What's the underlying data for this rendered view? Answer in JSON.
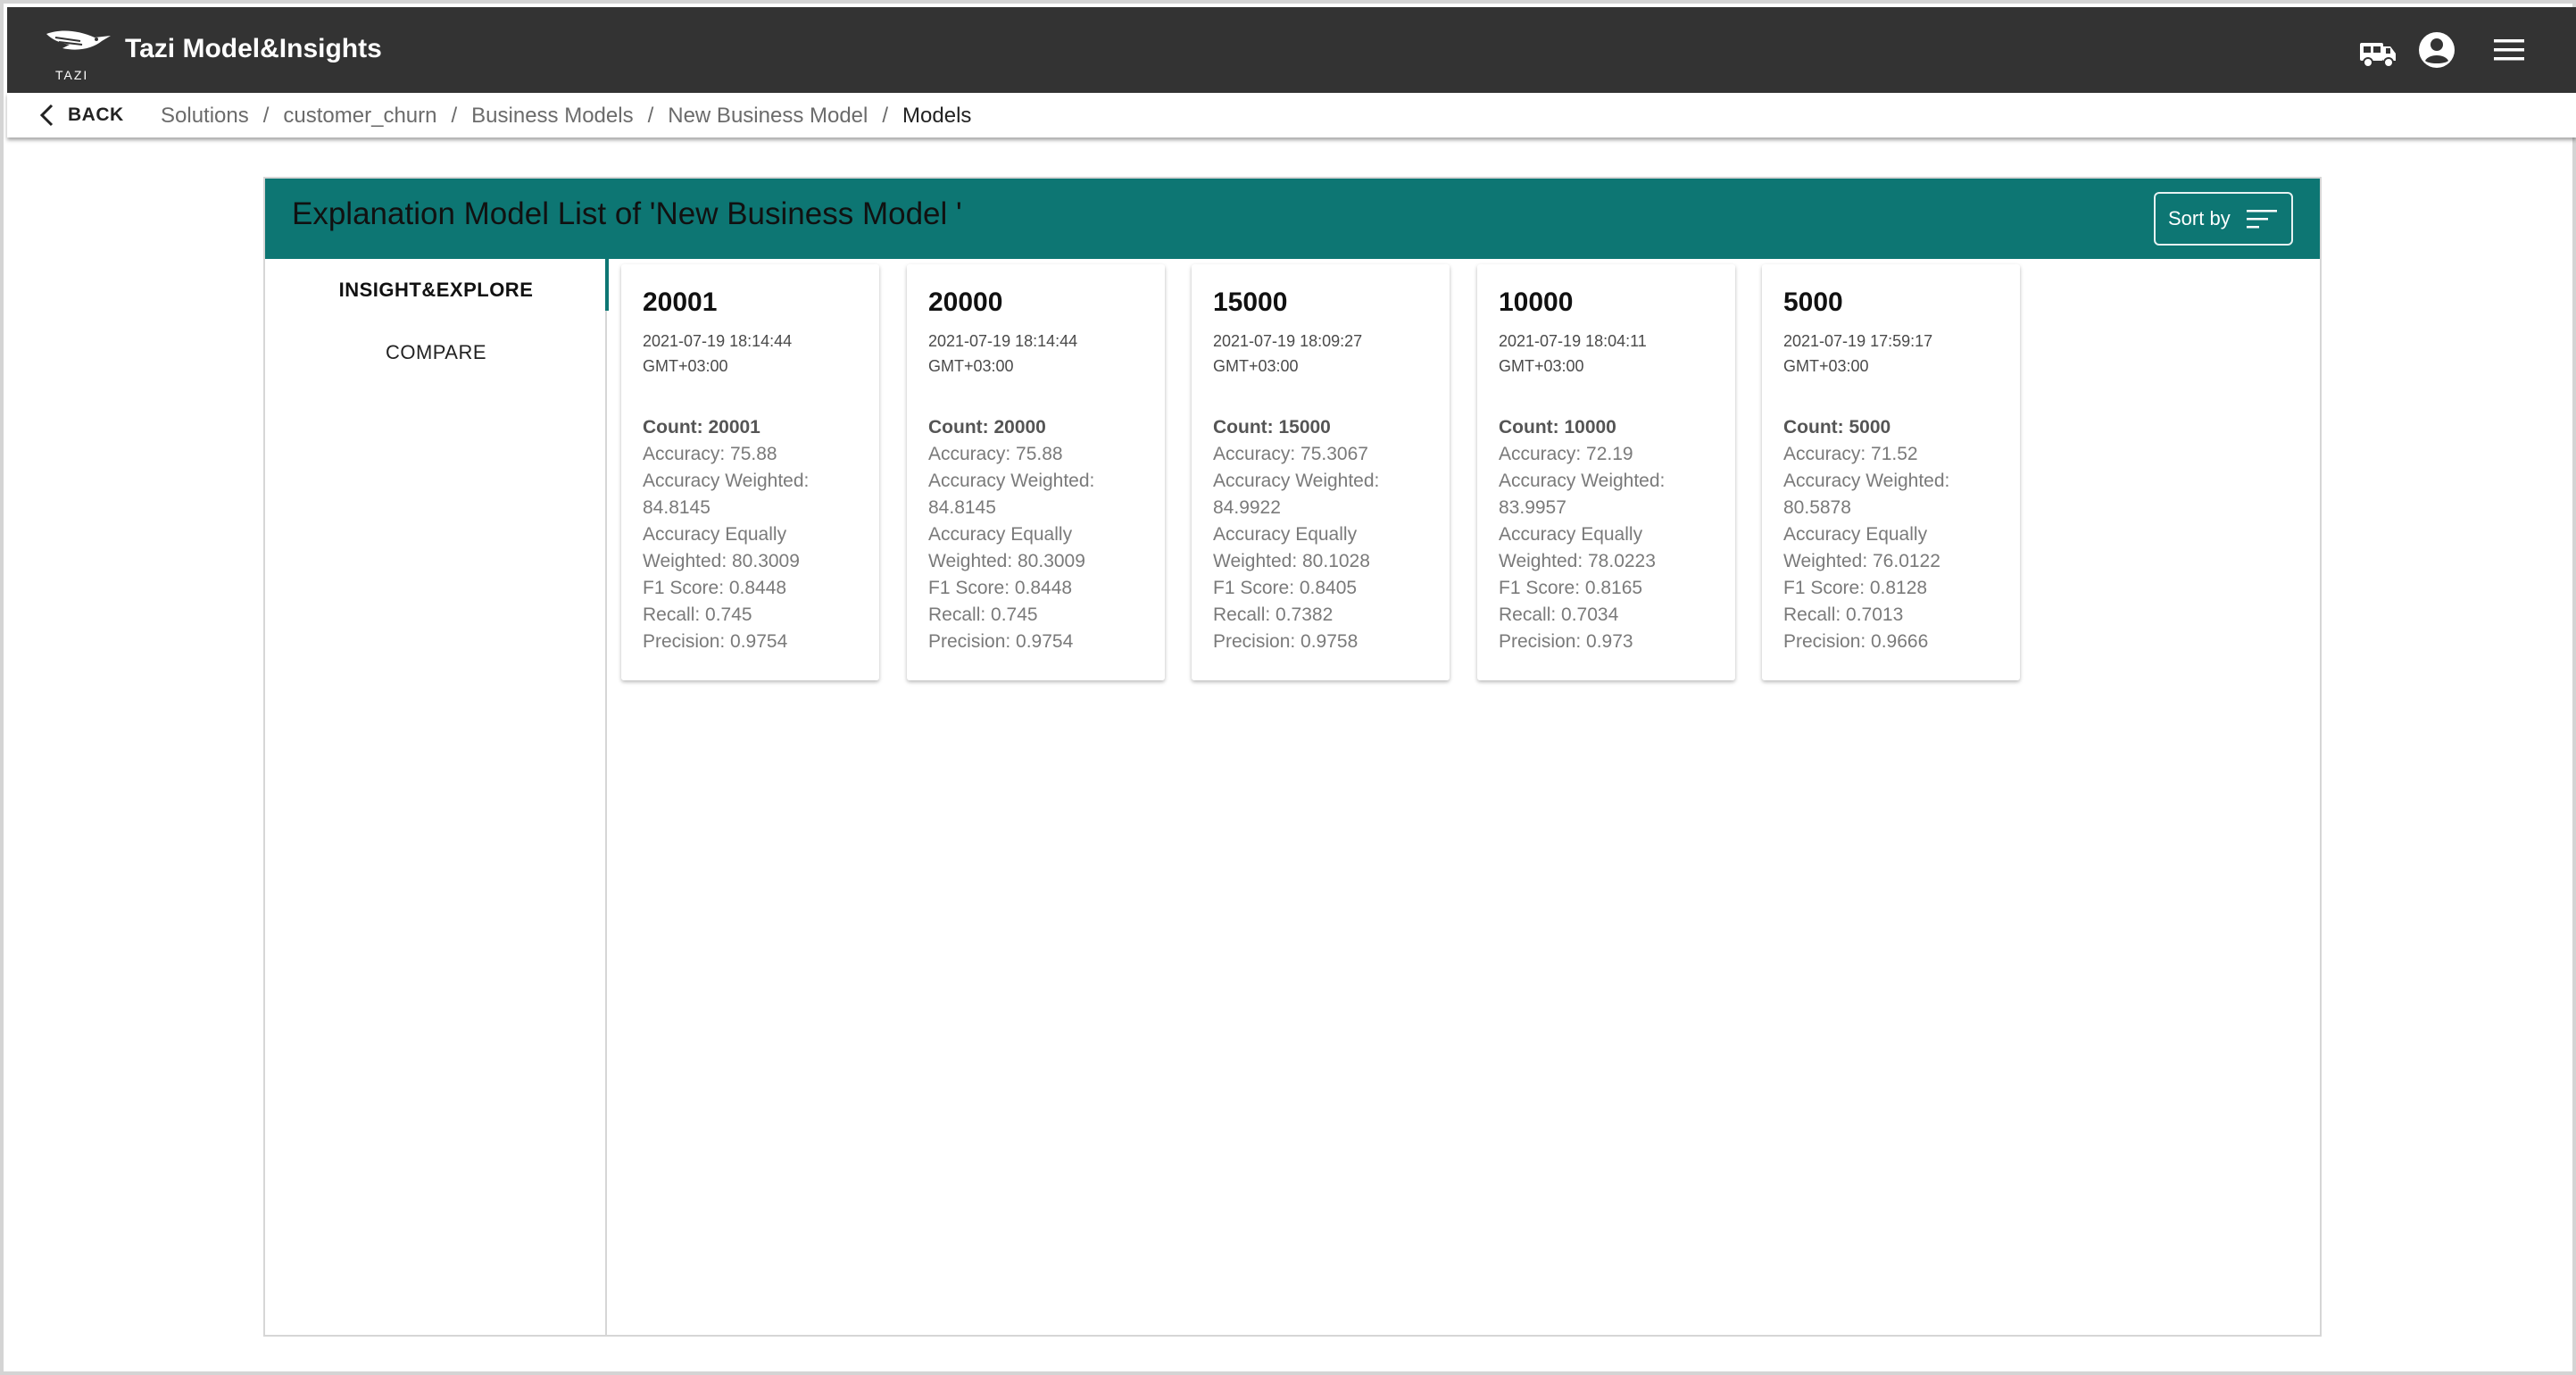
{
  "app": {
    "logo_text": "TAZI",
    "title": "Tazi Model&Insights"
  },
  "appbar_icons": [
    "truck-icon",
    "account-circle-icon",
    "menu-icon"
  ],
  "breadcrumb": {
    "back_label": "BACK",
    "items": [
      "Solutions",
      "customer_churn",
      "Business Models",
      "New Business Model",
      "Models"
    ],
    "separator": "/"
  },
  "panel": {
    "title": "Explanation Model List of 'New Business Model '",
    "sort_label": "Sort by",
    "header_color": "#0d7673"
  },
  "nav": {
    "tabs": [
      {
        "label": "INSIGHT&EXPLORE",
        "active": true
      },
      {
        "label": "COMPARE",
        "active": false
      }
    ]
  },
  "cards": [
    {
      "title": "20001",
      "date": "2021-07-19 18:14:44",
      "tz": "GMT+03:00",
      "count": "Count: 20001",
      "accuracy": "Accuracy: 75.88",
      "acc_weighted_label": "Accuracy Weighted:",
      "acc_weighted_value": "84.8145",
      "acc_equally_label": "Accuracy Equally",
      "acc_equally_value": "Weighted: 80.3009",
      "f1": "F1 Score: 0.8448",
      "recall": "Recall: 0.745",
      "precision": "Precision: 0.9754"
    },
    {
      "title": "20000",
      "date": "2021-07-19 18:14:44",
      "tz": "GMT+03:00",
      "count": "Count: 20000",
      "accuracy": "Accuracy: 75.88",
      "acc_weighted_label": "Accuracy Weighted:",
      "acc_weighted_value": "84.8145",
      "acc_equally_label": "Accuracy Equally",
      "acc_equally_value": "Weighted: 80.3009",
      "f1": "F1 Score: 0.8448",
      "recall": "Recall: 0.745",
      "precision": "Precision: 0.9754"
    },
    {
      "title": "15000",
      "date": "2021-07-19 18:09:27",
      "tz": "GMT+03:00",
      "count": "Count: 15000",
      "accuracy": "Accuracy: 75.3067",
      "acc_weighted_label": "Accuracy Weighted:",
      "acc_weighted_value": "84.9922",
      "acc_equally_label": "Accuracy Equally",
      "acc_equally_value": "Weighted: 80.1028",
      "f1": "F1 Score: 0.8405",
      "recall": "Recall: 0.7382",
      "precision": "Precision: 0.9758"
    },
    {
      "title": "10000",
      "date": "2021-07-19 18:04:11",
      "tz": "GMT+03:00",
      "count": "Count: 10000",
      "accuracy": "Accuracy: 72.19",
      "acc_weighted_label": "Accuracy Weighted:",
      "acc_weighted_value": "83.9957",
      "acc_equally_label": "Accuracy Equally",
      "acc_equally_value": "Weighted: 78.0223",
      "f1": "F1 Score: 0.8165",
      "recall": "Recall: 0.7034",
      "precision": "Precision: 0.973"
    },
    {
      "title": "5000",
      "date": "2021-07-19 17:59:17",
      "tz": "GMT+03:00",
      "count": "Count: 5000",
      "accuracy": "Accuracy: 71.52",
      "acc_weighted_label": "Accuracy Weighted:",
      "acc_weighted_value": "80.5878",
      "acc_equally_label": "Accuracy Equally",
      "acc_equally_value": "Weighted: 76.0122",
      "f1": "F1 Score: 0.8128",
      "recall": "Recall: 0.7013",
      "precision": "Precision: 0.9666"
    }
  ]
}
